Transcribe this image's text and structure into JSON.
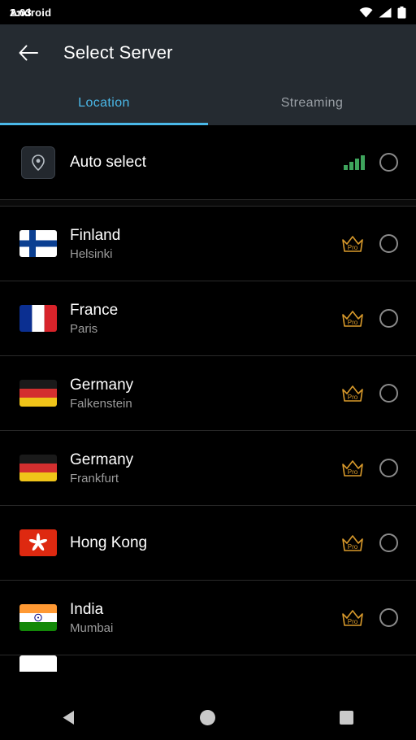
{
  "status_bar": {
    "time": "2:03",
    "app_label": "Android",
    "icons": [
      "wifi-icon",
      "cellular-signal-icon",
      "battery-icon"
    ]
  },
  "app_bar": {
    "back_icon": "arrow-back-icon",
    "title": "Select Server"
  },
  "tabs": [
    {
      "label": "Location",
      "active": true
    },
    {
      "label": "Streaming",
      "active": false
    }
  ],
  "colors": {
    "accent": "#4ab8e8",
    "appbar_bg": "#252b31",
    "page_bg": "#000000",
    "signal_green": "#3ea45c",
    "pro_gold": "#d99a2b",
    "secondary_text": "#9b9b9b"
  },
  "servers": [
    {
      "name": "Auto select",
      "city": "",
      "badge": "signal-bars",
      "selected": false,
      "icon": "location-pin-icon"
    },
    {
      "name": "Finland",
      "city": "Helsinki",
      "badge": "pro",
      "selected": false,
      "flag": "finland-flag"
    },
    {
      "name": "France",
      "city": "Paris",
      "badge": "pro",
      "selected": false,
      "flag": "france-flag"
    },
    {
      "name": "Germany",
      "city": "Falkenstein",
      "badge": "pro",
      "selected": false,
      "flag": "germany-flag"
    },
    {
      "name": "Germany",
      "city": "Frankfurt",
      "badge": "pro",
      "selected": false,
      "flag": "germany-flag"
    },
    {
      "name": "Hong Kong",
      "city": "",
      "badge": "pro",
      "selected": false,
      "flag": "hongkong-flag"
    },
    {
      "name": "India",
      "city": "Mumbai",
      "badge": "pro",
      "selected": false,
      "flag": "india-flag"
    }
  ],
  "pro_badge_label": "Pro",
  "nav_bar": {
    "back_label": "back-triangle",
    "home_label": "home-circle",
    "recents_label": "recents-square"
  }
}
